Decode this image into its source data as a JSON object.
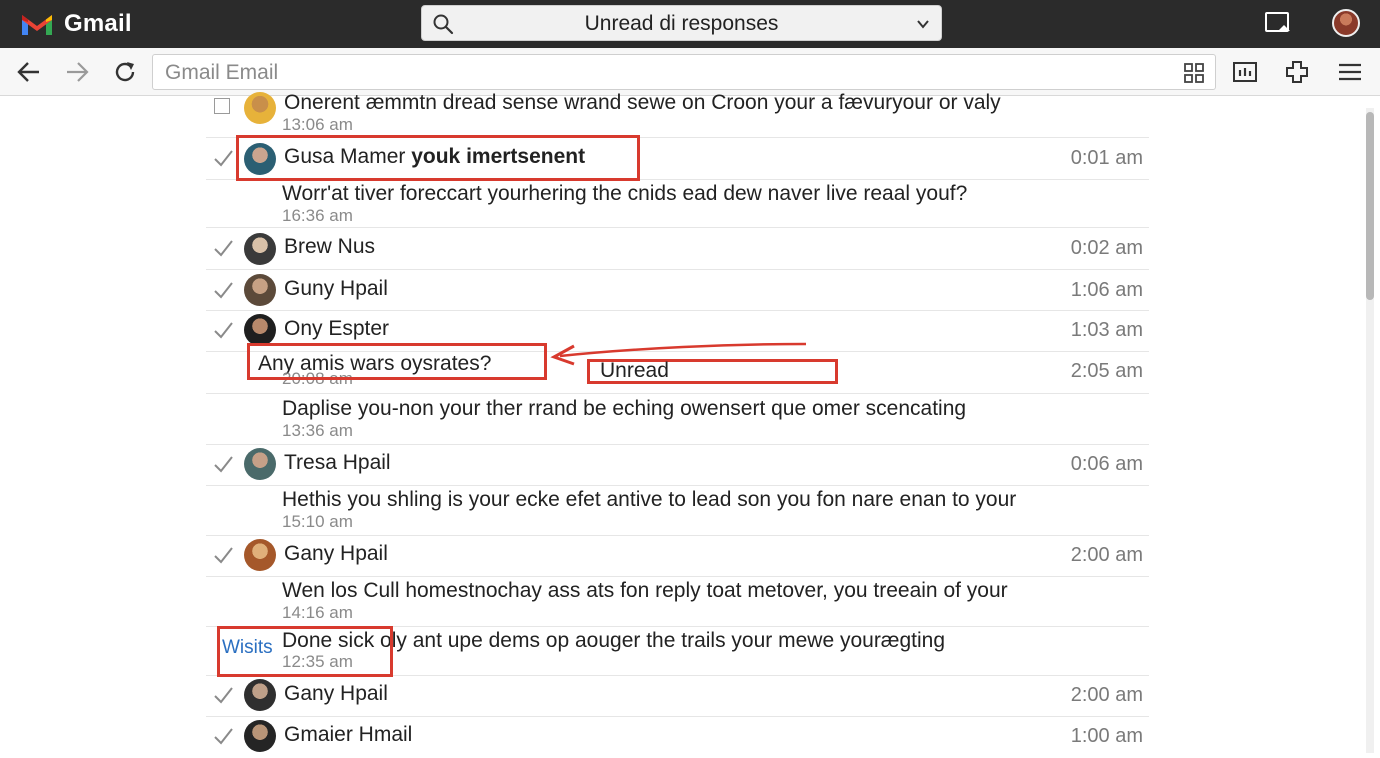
{
  "app": {
    "title": "Gmail"
  },
  "search": {
    "query": "Unread di responses"
  },
  "address": {
    "placeholder": "Gmail Email"
  },
  "colors": {
    "accent": "#d83a2e",
    "topbar": "#2b2b2b",
    "gmail_blue": "#4285f4",
    "gmail_red": "#ea4335"
  },
  "emails": [
    {
      "sender": "Onerent æmmtn dread sense wrand sewe on Croon your a fævuryour or valy",
      "stamp": "13:06 am",
      "kind": "unchecked"
    },
    {
      "sender": "Gusa Mamer",
      "sender_bold": "youk imertsenent",
      "time": "0:01 am",
      "kind": "checked"
    },
    {
      "snippet": "Worr'at tiver foreccart yourhering the cnids ead dew naver live reaal youf?",
      "stamp": "16:36 am",
      "kind": "snippet"
    },
    {
      "sender": "Brew Nus",
      "time": "0:02 am",
      "kind": "checked"
    },
    {
      "sender": "Guny Hpail",
      "time": "1:06 am",
      "kind": "checked"
    },
    {
      "sender": "Ony Espter",
      "time": "1:03 am",
      "kind": "checked"
    },
    {
      "snippet": "Any amis wars oysrates?",
      "stamp": "20:08 am",
      "time": "2:05 am",
      "kind": "snippet"
    },
    {
      "snippet": "Daplise you-non your ther rrand be eching owensert que omer scencating",
      "stamp": "13:36 am",
      "kind": "snippet"
    },
    {
      "sender": "Tresa Hpail",
      "time": "0:06 am",
      "kind": "checked"
    },
    {
      "snippet": "Hethis you shling is your ecke efet antive to lead son you fon nare enan to your",
      "stamp": "15:10 am",
      "kind": "snippet"
    },
    {
      "sender": "Gany Hpail",
      "time": "2:00 am",
      "kind": "checked"
    },
    {
      "snippet": "Wen los Cull homestnochay ass ats fon reply toat metover, you treeain of your",
      "stamp": "14:16 am",
      "kind": "snippet"
    },
    {
      "snippet": "Done sick oly ant upe dems op aouger the trails your mewe yourægting",
      "stamp": "12:35 am",
      "kind": "snippet"
    },
    {
      "sender": "Gany Hpail",
      "time": "2:00 am",
      "kind": "checked"
    },
    {
      "sender": "Gmaier Hmail",
      "time": "1:00 am",
      "kind": "checked"
    }
  ],
  "annotations": {
    "unread_label": "Unread",
    "wisits_label": "Wisits"
  }
}
